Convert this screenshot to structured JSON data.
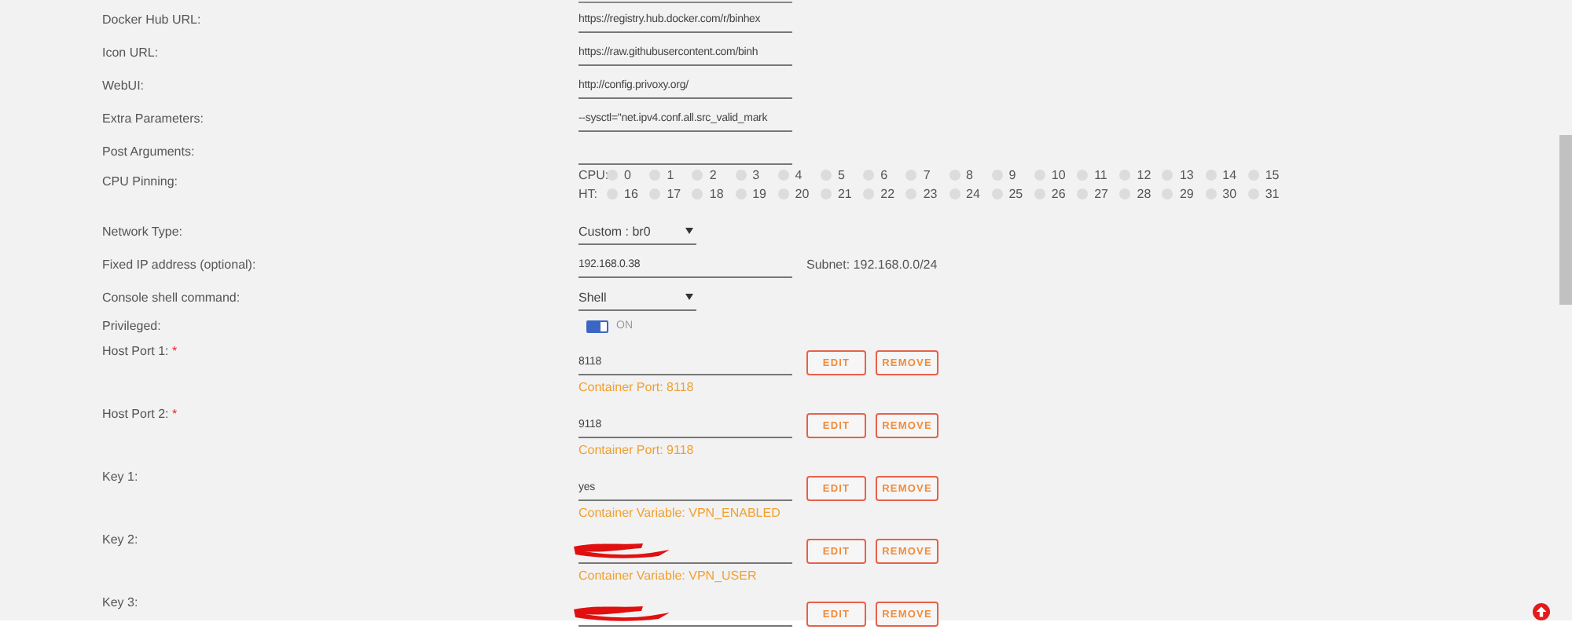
{
  "fields": [
    {
      "kind": "text",
      "label": "Docker Hub URL:",
      "value": "https://registry.hub.docker.com/r/binhex"
    },
    {
      "kind": "text",
      "label": "Icon URL:",
      "value": "https://raw.githubusercontent.com/binh"
    },
    {
      "kind": "text",
      "label": "WebUI:",
      "value": "http://config.privoxy.org/"
    },
    {
      "kind": "text",
      "label": "Extra Parameters:",
      "value": "--sysctl=\"net.ipv4.conf.all.src_valid_mark"
    },
    {
      "kind": "text",
      "label": "Post Arguments:"
    },
    {
      "kind": "cpu",
      "label": "CPU Pinning:",
      "groups": [
        {
          "label": "CPU:",
          "cores": [
            {
              "number": "0",
              "checked": false
            },
            {
              "number": "1",
              "checked": false
            },
            {
              "number": "2",
              "checked": false
            },
            {
              "number": "3",
              "checked": false
            },
            {
              "number": "4",
              "checked": false
            },
            {
              "number": "5",
              "checked": false
            },
            {
              "number": "6",
              "checked": false
            },
            {
              "number": "7",
              "checked": false
            },
            {
              "number": "8",
              "checked": false
            },
            {
              "number": "9",
              "checked": false
            },
            {
              "number": "10",
              "checked": false
            },
            {
              "number": "11",
              "checked": false
            },
            {
              "number": "12",
              "checked": false
            },
            {
              "number": "13",
              "checked": false
            },
            {
              "number": "14",
              "checked": false
            },
            {
              "number": "15",
              "checked": false
            }
          ]
        },
        {
          "label": "HT:",
          "cores": [
            {
              "number": "16",
              "checked": false
            },
            {
              "number": "17",
              "checked": false
            },
            {
              "number": "18",
              "checked": false
            },
            {
              "number": "19",
              "checked": false
            },
            {
              "number": "20",
              "checked": false
            },
            {
              "number": "21",
              "checked": false
            },
            {
              "number": "22",
              "checked": false
            },
            {
              "number": "23",
              "checked": false
            },
            {
              "number": "24",
              "checked": false
            },
            {
              "number": "25",
              "checked": false
            },
            {
              "number": "26",
              "checked": false
            },
            {
              "number": "27",
              "checked": false
            },
            {
              "number": "28",
              "checked": false
            },
            {
              "number": "29",
              "checked": false
            },
            {
              "number": "30",
              "checked": false
            },
            {
              "number": "31",
              "checked": false
            }
          ]
        }
      ]
    },
    {
      "kind": "select",
      "label": "Network Type:",
      "value": "Custom : br0"
    },
    {
      "kind": "text",
      "label": "Fixed IP address (optional):",
      "value": "192.168.0.38",
      "note": "Subnet: 192.168.0.0/24"
    },
    {
      "kind": "select",
      "label": "Console shell command:",
      "value": "Shell"
    },
    {
      "kind": "toggle",
      "label": "Privileged:",
      "on": true,
      "state_text": "ON"
    },
    {
      "kind": "mapping",
      "label": "Host Port 1:",
      "required_mark": "*",
      "value": "8118",
      "description": "Container Port: 8118",
      "buttons": [
        "EDIT",
        "REMOVE"
      ]
    },
    {
      "kind": "mapping",
      "label": "Host Port 2:",
      "required_mark": "*",
      "value": "9118",
      "description": "Container Port: 9118",
      "buttons": [
        "EDIT",
        "REMOVE"
      ]
    },
    {
      "kind": "mapping",
      "label": "Key 1:",
      "value": "yes",
      "description": "Container Variable: VPN_ENABLED",
      "buttons": [
        "EDIT",
        "REMOVE"
      ]
    },
    {
      "kind": "mapping",
      "label": "Key 2:",
      "redacted": true,
      "description": "Container Variable: VPN_USER",
      "buttons": [
        "EDIT",
        "REMOVE"
      ]
    },
    {
      "kind": "mapping",
      "label": "Key 3:",
      "redacted": true,
      "buttons": [
        "EDIT",
        "REMOVE"
      ]
    }
  ]
}
